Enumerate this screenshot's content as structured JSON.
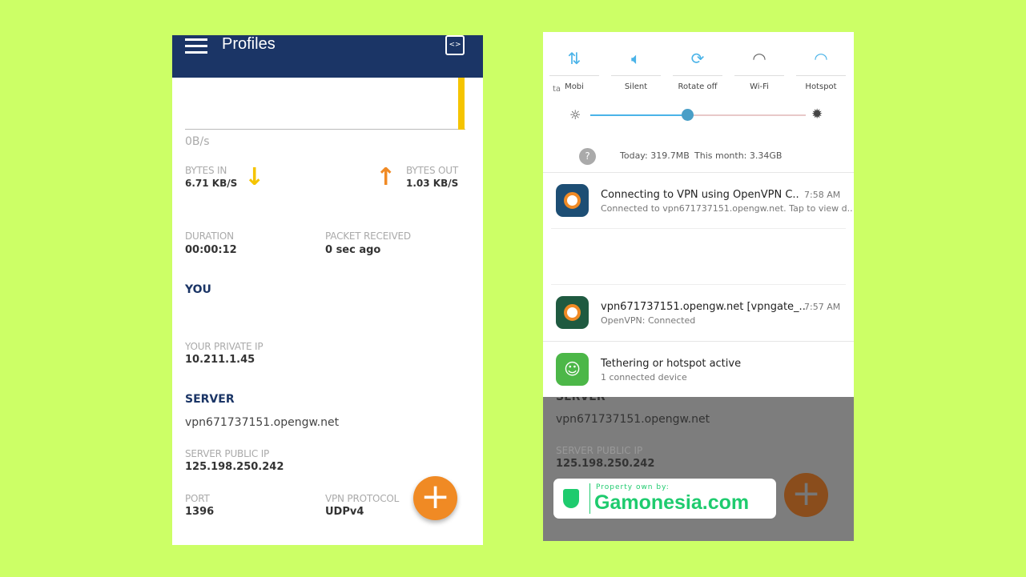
{
  "left": {
    "header": {
      "title": "Profiles",
      "menu_icon": "hamburger-icon",
      "log_icon": "log-scroll-icon"
    },
    "graph": {
      "rate_label": "0B/s",
      "bar_color": "#f5c400"
    },
    "bytes_in": {
      "label": "BYTES IN",
      "value": "6.71 KB/S",
      "icon": "arrow-down-icon",
      "color": "#f5c400"
    },
    "bytes_out": {
      "label": "BYTES OUT",
      "value": "1.03 KB/S",
      "icon": "arrow-up-icon",
      "color": "#f08a24"
    },
    "duration": {
      "label": "DURATION",
      "value": "00:00:12"
    },
    "packet": {
      "label": "PACKET RECEIVED",
      "value": "0 sec ago"
    },
    "you": {
      "title": "YOU",
      "private_ip_label": "YOUR PRIVATE IP",
      "private_ip": "10.211.1.45"
    },
    "server": {
      "title": "SERVER",
      "host": "vpn671737151.opengw.net",
      "public_ip_label": "SERVER PUBLIC IP",
      "public_ip": "125.198.250.242",
      "port_label": "PORT",
      "port": "1396",
      "protocol_label": "VPN PROTOCOL",
      "protocol": "UDPv4"
    },
    "fab": {
      "icon": "plus-icon",
      "color": "#f08a24"
    }
  },
  "right": {
    "quick_settings": [
      {
        "label": "Mobi",
        "icon": "data-arrows-icon"
      },
      {
        "label": "Silent",
        "icon": "speaker-icon"
      },
      {
        "label": "Rotate off",
        "icon": "rotate-icon"
      },
      {
        "label": "Wi-Fi",
        "icon": "wifi-icon"
      },
      {
        "label": "Hotspot",
        "icon": "hotspot-icon"
      }
    ],
    "partial_label": "ta",
    "brightness": {
      "level": 0.45
    },
    "data_usage": {
      "today": "Today: 319.7MB",
      "month": "This month: 3.34GB"
    },
    "notifications": [
      {
        "title": "Connecting to VPN using OpenVPN C..",
        "sub": "Connected to vpn671737151.opengw.net. Tap to view d..",
        "time": "7:58 AM",
        "icon": "openvpn-icon"
      },
      {
        "title": "vpn671737151.opengw.net [vpngate_..",
        "sub": "OpenVPN: Connected",
        "time": "7:57 AM",
        "icon": "openvpn-icon"
      },
      {
        "title": "Tethering or hotspot active",
        "sub": "1 connected device",
        "time": "",
        "icon": "android-icon"
      }
    ],
    "behind": {
      "server_title": "SERVER",
      "host": "vpn671737151.opengw.net",
      "public_ip_label": "SERVER PUBLIC IP",
      "public_ip": "125.198.250.242"
    }
  },
  "watermark": {
    "caption": "Property own by:",
    "brand": "Gamonesia.com",
    "color": "#1ecb6e"
  }
}
